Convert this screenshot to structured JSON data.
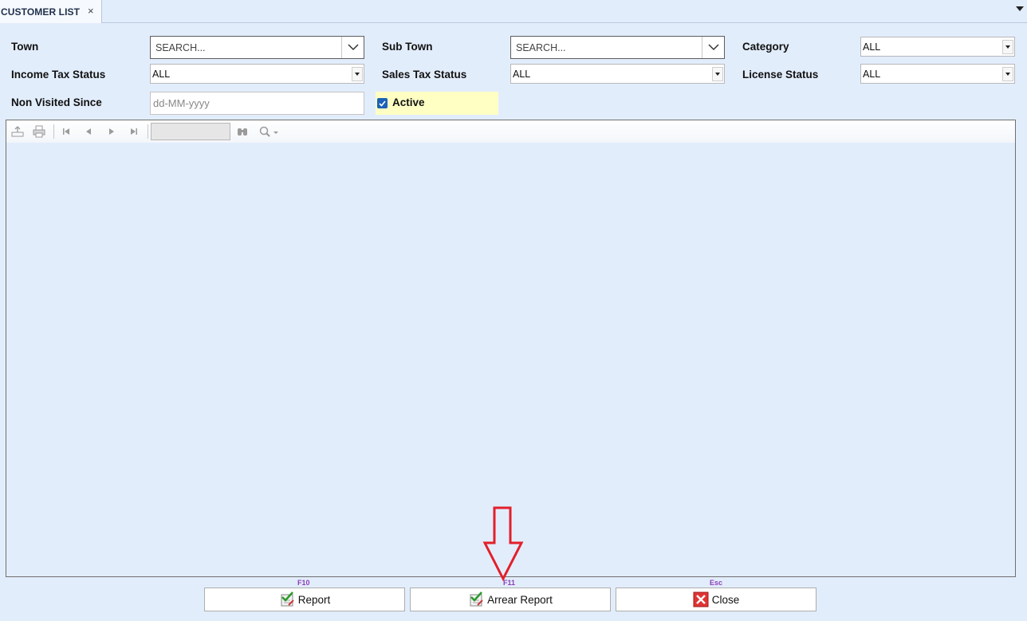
{
  "tab": {
    "title": "CUSTOMER LIST",
    "close_glyph": "×"
  },
  "filters": {
    "town": {
      "label": "Town",
      "placeholder": "SEARCH..."
    },
    "sub_town": {
      "label": "Sub Town",
      "placeholder": "SEARCH..."
    },
    "category": {
      "label": "Category",
      "value": "ALL"
    },
    "income_tax_status": {
      "label": "Income Tax Status",
      "value": "ALL"
    },
    "sales_tax_status": {
      "label": "Sales Tax Status",
      "value": "ALL"
    },
    "license_status": {
      "label": "License Status",
      "value": "ALL"
    },
    "non_visited_since": {
      "label": "Non Visited Since",
      "placeholder": "dd-MM-yyyy"
    },
    "active": {
      "label": "Active",
      "checked": true
    }
  },
  "viewer_toolbar": {
    "icons": [
      "export-icon",
      "print-icon",
      "first-page-icon",
      "prev-page-icon",
      "next-page-icon",
      "last-page-icon",
      "find-icon",
      "zoom-icon"
    ],
    "page_value": ""
  },
  "buttons": {
    "report": {
      "label": "Report",
      "shortcut": "F10",
      "icon": "check-report-icon"
    },
    "arrear_report": {
      "label": "Arrear Report",
      "shortcut": "F11",
      "icon": "check-report-icon"
    },
    "close": {
      "label": "Close",
      "shortcut": "Esc",
      "icon": "red-x-icon"
    }
  },
  "colors": {
    "background": "#e2edfc",
    "active_highlight": "#ffffc4",
    "shortcut_text": "#8b3fb8",
    "annotation_arrow": "#e2202a",
    "checkbox": "#1c62b8"
  },
  "annotation": {
    "type": "down-arrow",
    "points_to": "arrear_report"
  }
}
